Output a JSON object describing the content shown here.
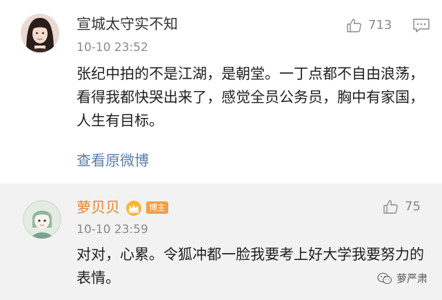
{
  "comments": [
    {
      "username": "宣城太守实不知",
      "time": "10-10 23:52",
      "likes": "713",
      "text": "张纪中拍的不是江湖，是朝堂。一丁点都不自由浪荡，看得我都快哭出来了，感觉全员公务员，胸中有家国，人生有目标。",
      "view_original": "查看原微博"
    },
    {
      "username": "萝贝贝",
      "badge": "博主",
      "time": "10-10 23:59",
      "likes": "75",
      "text": "对对，心累。令狐冲都一脸我要考上好大学我要努力的表情。"
    }
  ],
  "watermark": "萝严肃",
  "colors": {
    "username_highlight": "#e8852f",
    "link": "#5a7fa8",
    "secondary_background": "#f2f2f2"
  }
}
